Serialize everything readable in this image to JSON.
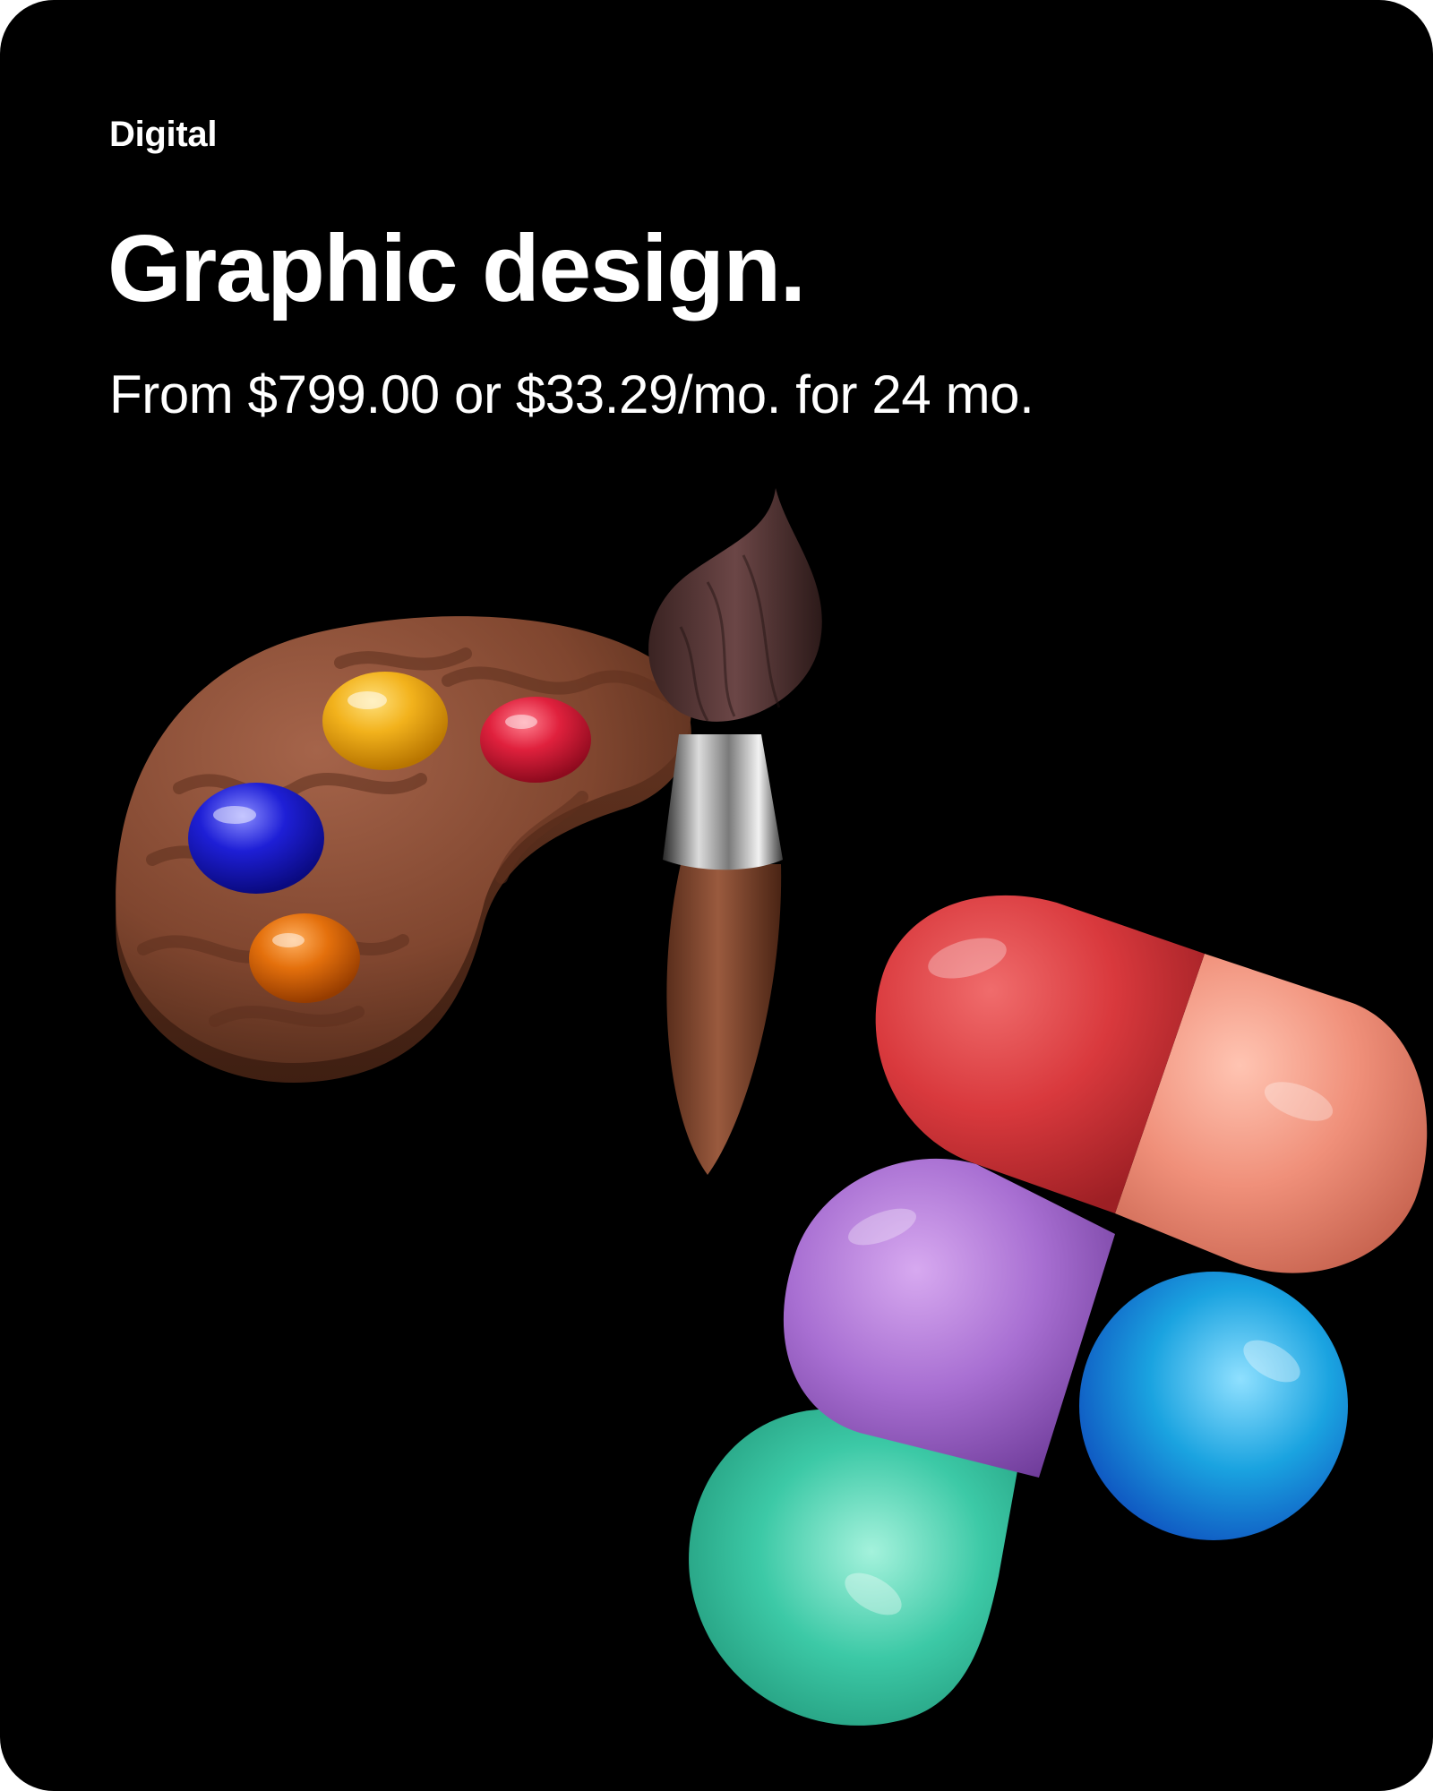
{
  "card": {
    "eyebrow": "Digital",
    "headline": "Graphic design.",
    "price": "From $799.00 or $33.29/mo. for 24 mo."
  },
  "illustrations": {
    "palette": {
      "icon": "paint-palette-icon",
      "paint_colors": [
        "#f2b21c",
        "#e0213d",
        "#1e1fd6",
        "#e4700c"
      ],
      "wood_color": "#8a4e36"
    },
    "brush": {
      "icon": "paintbrush-icon"
    },
    "design_app_logo": {
      "icon": "design-app-logo-icon",
      "colors": [
        "#d9393d",
        "#f0907a",
        "#a86fd2",
        "#1aa3e0",
        "#3cc9a6"
      ]
    }
  },
  "theme": {
    "background": "#000000",
    "text": "#ffffff"
  }
}
